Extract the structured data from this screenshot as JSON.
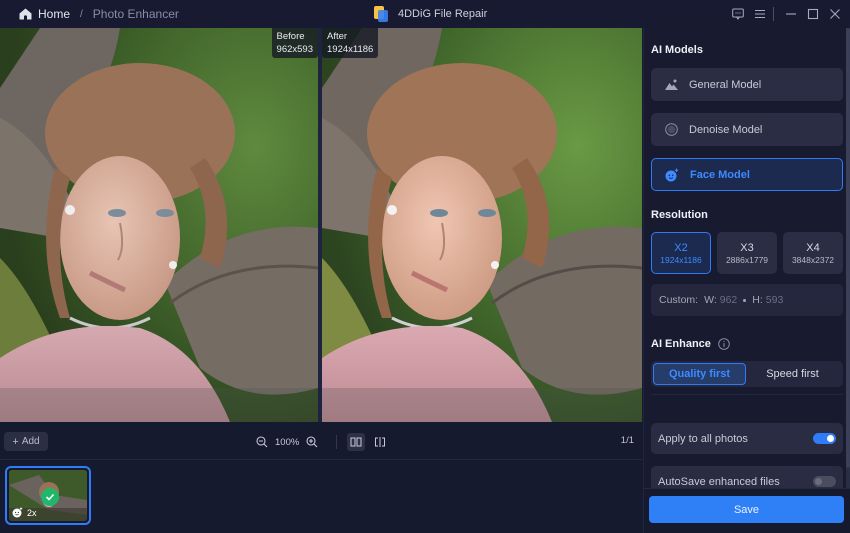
{
  "titlebar": {
    "home_label": "Home",
    "separator": "/",
    "current_page": "Photo Enhancer",
    "app_title": "4DDiG File Repair",
    "controls": [
      "feedback-icon",
      "menu-icon",
      "minimize-icon",
      "maximize-icon",
      "close-icon"
    ]
  },
  "viewer": {
    "before": {
      "label": "Before",
      "size": "962x593"
    },
    "after": {
      "label": "After",
      "size": "1924x1186"
    }
  },
  "toolbar": {
    "add_label": "Add",
    "zoom_level": "100%",
    "page_counter": "1/1"
  },
  "thumbnails": [
    {
      "scale_label": "2x",
      "selected": true,
      "status": "done"
    }
  ],
  "panel": {
    "ai_models_title": "AI Models",
    "models": [
      {
        "label": "General Model",
        "icon": "landscape-icon",
        "active": false
      },
      {
        "label": "Denoise Model",
        "icon": "denoise-icon",
        "active": false
      },
      {
        "label": "Face Model",
        "icon": "face-sparkle-icon",
        "active": true
      }
    ],
    "resolution_title": "Resolution",
    "resolutions": [
      {
        "scale": "X2",
        "size": "1924x1186",
        "active": true
      },
      {
        "scale": "X3",
        "size": "2886x1779",
        "active": false
      },
      {
        "scale": "X4",
        "size": "3848x2372",
        "active": false
      }
    ],
    "custom": {
      "label": "Custom:",
      "w_label": "W:",
      "w_value": "962",
      "h_label": "H:",
      "h_value": "593"
    },
    "ai_enhance_title": "AI Enhance",
    "enhance_options": [
      {
        "label": "Quality first",
        "active": true
      },
      {
        "label": "Speed first",
        "active": false
      }
    ],
    "toggles": [
      {
        "label": "Apply to all photos",
        "on": true
      },
      {
        "label": "AutoSave enhanced files",
        "on": false
      }
    ],
    "save_label": "Save"
  },
  "colors": {
    "accent": "#2f7cf6",
    "background": "#161a2e",
    "success": "#1fb76a"
  }
}
